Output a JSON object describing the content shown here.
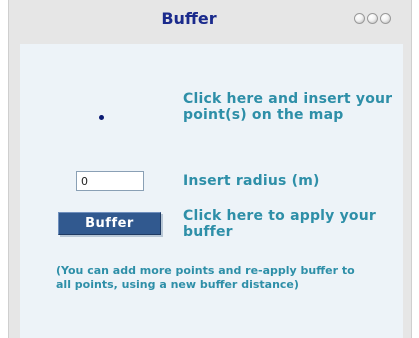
{
  "window": {
    "title": "Buffer"
  },
  "panel": {
    "insert_point_text": "Click here and insert your point(s) on the map",
    "radius_input": {
      "value": "0"
    },
    "radius_label": "Insert radius (m)",
    "buffer_button_label": "Buffer",
    "apply_text": "Click here to apply your buffer",
    "note": "(You can add more points and re-apply buffer to all points, using a new buffer distance)"
  },
  "colors": {
    "title": "#1a2a8c",
    "text": "#2e8fa8",
    "button": "#31598f",
    "panel_bg": "#edf3f8",
    "frame_bg": "#e6e6e6",
    "point": "#0b1a73"
  },
  "icons": [
    "point-tool-icon",
    "window-control-icon"
  ]
}
